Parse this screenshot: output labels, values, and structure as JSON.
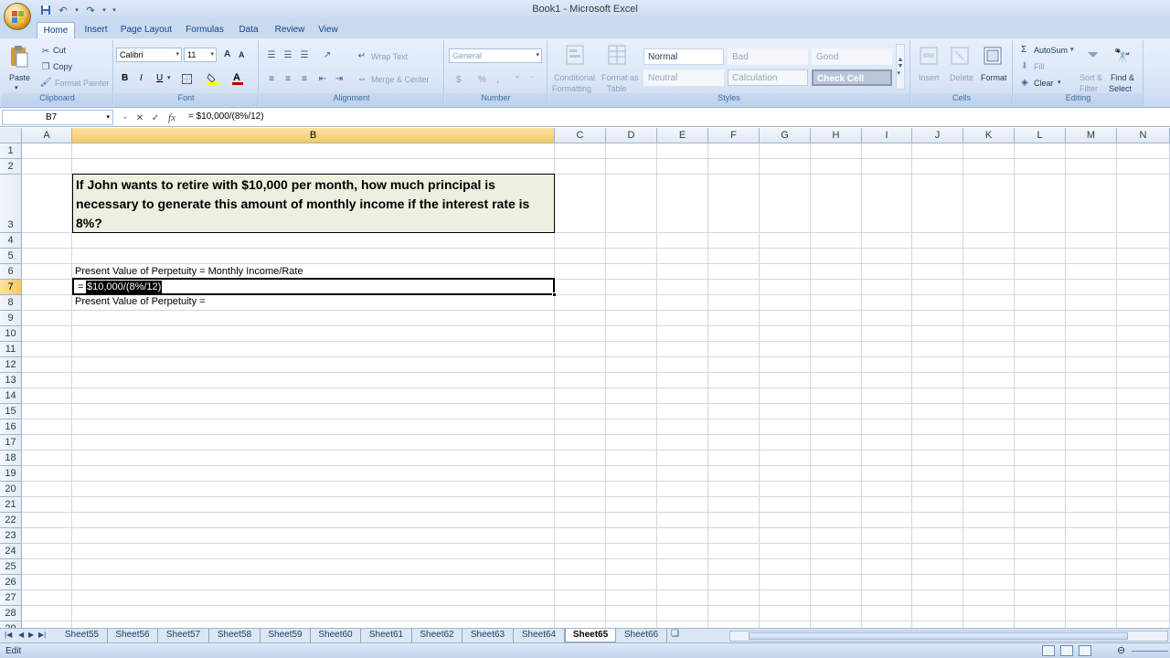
{
  "window": {
    "title": "Book1 - Microsoft Excel"
  },
  "tabs": [
    "Home",
    "Insert",
    "Page Layout",
    "Formulas",
    "Data",
    "Review",
    "View"
  ],
  "ribbon": {
    "clipboard": {
      "paste": "Paste",
      "cut": "Cut",
      "copy": "Copy",
      "format_painter": "Format Painter",
      "label": "Clipboard"
    },
    "font": {
      "name": "Calibri",
      "size": "11",
      "bold": "B",
      "italic": "I",
      "underline": "U",
      "grow": "A",
      "shrink": "A",
      "label": "Font"
    },
    "alignment": {
      "wrap_text": "Wrap Text",
      "merge_center": "Merge & Center",
      "label": "Alignment"
    },
    "number": {
      "format": "General",
      "currency": "$",
      "percent": "%",
      "comma": ",",
      "label": "Number"
    },
    "styles": {
      "conditional_line1": "Conditional",
      "conditional_line2": "Formatting",
      "format_table_line1": "Format as",
      "format_table_line2": "Table",
      "normal": "Normal",
      "bad": "Bad",
      "good": "Good",
      "neutral": "Neutral",
      "calculation": "Calculation",
      "check_cell": "Check Cell",
      "label": "Styles"
    },
    "cells": {
      "insert": "Insert",
      "delete": "Delete",
      "format": "Format",
      "label": "Cells"
    },
    "editing": {
      "autosum": "AutoSum",
      "fill": "Fill",
      "clear": "Clear",
      "sort_line1": "Sort &",
      "sort_line2": "Filter",
      "find_line1": "Find &",
      "find_line2": "Select",
      "label": "Editing"
    },
    "colors": {
      "fill": "#ffff00",
      "font": "#c00000"
    }
  },
  "formula_bar": {
    "name_box": "B7",
    "fx": "fx",
    "formula": "= $10,000/(8%/12)"
  },
  "columns": [
    "A",
    "B",
    "C",
    "D",
    "E",
    "F",
    "G",
    "H",
    "I",
    "J",
    "K",
    "L",
    "M",
    "N"
  ],
  "rows": [
    "1",
    "2",
    "3",
    "4",
    "5",
    "6",
    "7",
    "8",
    "9",
    "10",
    "11",
    "12",
    "13",
    "14",
    "15",
    "16",
    "17",
    "18",
    "19",
    "20",
    "21",
    "22",
    "23",
    "24",
    "25",
    "26",
    "27",
    "28",
    "29"
  ],
  "cells": {
    "B3": "If John wants to retire with $10,000 per month, how much principal is necessary to generate this amount of monthly income if the interest rate is 8%?",
    "B6": "Present Value of Perpetuity = Monthly Income/Rate",
    "B7_prefix": "=",
    "B7_selected": "$10,000/(8%/12)",
    "B8": "Present Value of Perpetuity ="
  },
  "sheets": [
    "Sheet55",
    "Sheet56",
    "Sheet57",
    "Sheet58",
    "Sheet59",
    "Sheet60",
    "Sheet61",
    "Sheet62",
    "Sheet63",
    "Sheet64",
    "Sheet65",
    "Sheet66"
  ],
  "active_sheet": "Sheet65",
  "status": {
    "mode": "Edit"
  }
}
